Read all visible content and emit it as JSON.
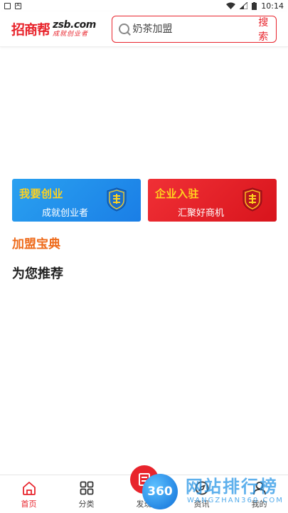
{
  "status_bar": {
    "time": "10:14",
    "left_icons": [
      "square-icon",
      "a-icon"
    ],
    "right_icons": [
      "wifi-icon",
      "signal-icon",
      "battery-icon"
    ]
  },
  "header": {
    "logo_cn": "招商帮",
    "logo_en": "zsb.com",
    "logo_slogan": "成就创业者",
    "search": {
      "placeholder": "奶茶加盟",
      "button_label": "搜索"
    }
  },
  "banners": [
    {
      "title": "我要创业",
      "subtitle": "成就创业者",
      "color": "#1f8be8",
      "icon": "shield-bang-icon"
    },
    {
      "title": "企业入驻",
      "subtitle": "汇聚好商机",
      "color": "#e41e26",
      "icon": "shield-bang-icon"
    }
  ],
  "sections": {
    "jiameng_baodian": "加盟宝典",
    "recommend": "为您推荐"
  },
  "bottom_nav": {
    "items": [
      {
        "label": "首页",
        "icon": "home-icon",
        "active": true
      },
      {
        "label": "分类",
        "icon": "grid-icon",
        "active": false
      },
      {
        "label": "发现",
        "icon": "discover-icon",
        "active": false
      },
      {
        "label": "资讯",
        "icon": "compass-icon",
        "active": false
      },
      {
        "label": "我的",
        "icon": "user-icon",
        "active": false
      }
    ]
  },
  "watermark": {
    "badge": "360",
    "text": "网站排行榜",
    "sub": "WANGZHAN360.COM"
  },
  "colors": {
    "brand_red": "#e8242c",
    "accent_orange": "#ee6a1a",
    "banner_blue": "#1f8be8",
    "banner_red": "#e41e26",
    "banner_title_yellow": "#ffd21f"
  }
}
